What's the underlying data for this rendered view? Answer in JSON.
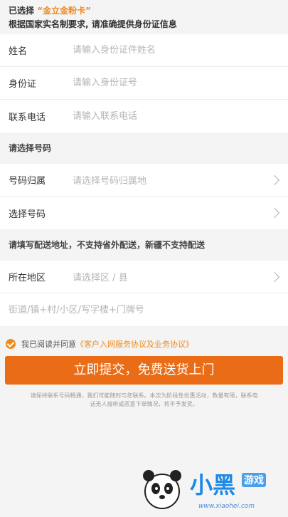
{
  "header": {
    "selected_prefix": "已选择",
    "selected_card": "“金立金粉卡”",
    "notice": "根据国家实名制要求, 请准确提供身份证信息"
  },
  "identity": {
    "name_label": "姓名",
    "name_placeholder": "请输入身份证件姓名",
    "id_label": "身份证",
    "id_placeholder": "请输入身份证号",
    "phone_label": "联系电话",
    "phone_placeholder": "请输入联系电话"
  },
  "number_section": {
    "title": "请选择号码",
    "region_label": "号码归属",
    "region_placeholder": "请选择号码归属地",
    "select_label": "选择号码"
  },
  "address_section": {
    "title": "请填写配送地址，不支持省外配送，新疆不支持配送",
    "area_label": "所在地区",
    "area_placeholder": "请选择区 / 县",
    "street_placeholder": "街道/镇+村/小区/写字楼+门牌号"
  },
  "agreement": {
    "prefix": "我已阅读并同意",
    "link": "《客户入网服务协议及业务协议》"
  },
  "submit_label": "立即提交，免费送货上门",
  "footer_notice": "请保持联系号码畅通，我们可能随时与您联系。本次为阶段性优惠活动，数量有限，联系电话无人接听或恶意下单情况，将不予发货。",
  "watermark": {
    "brand": "小黑",
    "tag": "游戏",
    "url": "www.xiaohei.com"
  },
  "colors": {
    "accent": "#f08a1d",
    "button": "#ea6c17",
    "brand": "#1e88e5"
  }
}
